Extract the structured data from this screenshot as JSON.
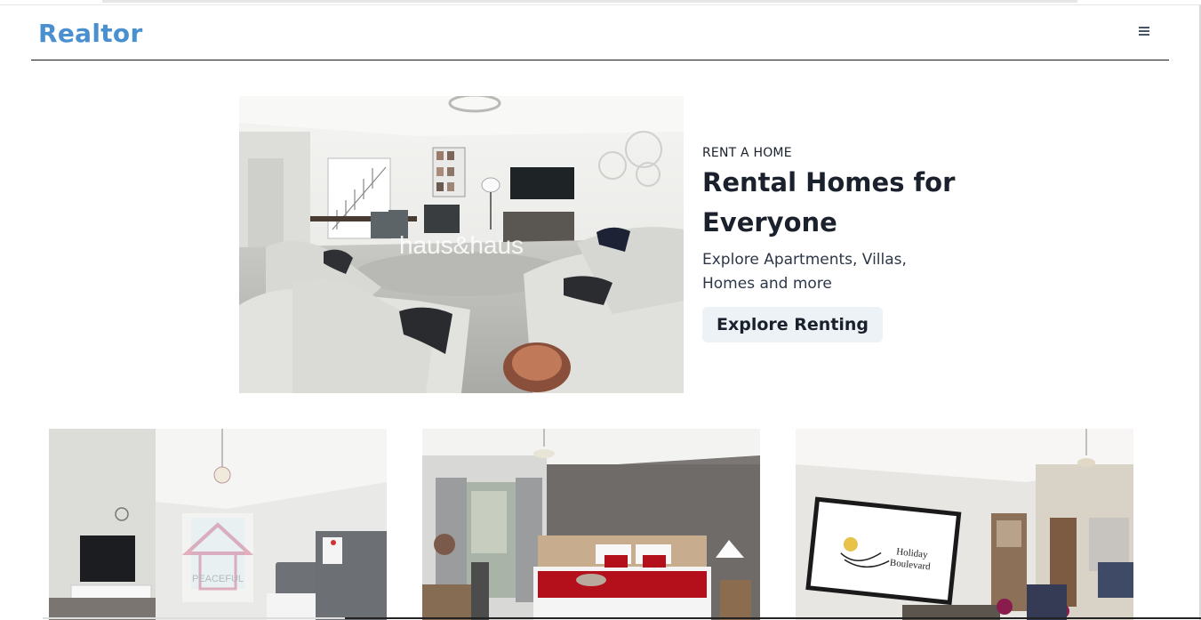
{
  "header": {
    "logo": "Realtor",
    "menu_icon": "hamburger-menu-icon"
  },
  "hero": {
    "eyebrow": "RENT A HOME",
    "title_line1": "Rental Homes for",
    "title_line2": "Everyone",
    "description": "Explore Apartments, Villas, Homes and more",
    "button_label": "Explore Renting",
    "image_watermark": "haus&haus"
  },
  "cards": [
    {
      "image_alt": "Studio apartment bedroom",
      "watermark": "PEACEFUL"
    },
    {
      "image_alt": "Bedroom with red bedding"
    },
    {
      "image_alt": "Living room with TV",
      "tv_text_line1": "Holiday",
      "tv_text_line2": "Boulevard"
    }
  ],
  "colors": {
    "brand": "#4a90d0",
    "button_bg": "#edf2f7",
    "text": "#1a202c"
  }
}
